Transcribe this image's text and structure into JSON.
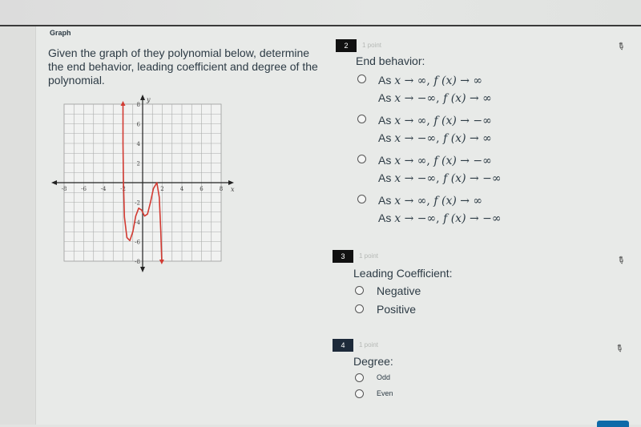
{
  "section_label": "Graph",
  "prompt": "Given the graph of they polynomial below, determine the end behavior, leading coefficient and degree of the polynomial.",
  "graph": {
    "x_axis_label": "x",
    "y_axis_label": "y",
    "x_ticks": [
      "-8",
      "-6",
      "-4",
      "-2",
      "2",
      "4",
      "6",
      "8"
    ],
    "y_ticks": [
      "8",
      "6",
      "4",
      "2",
      "-2",
      "-4",
      "-6",
      "-8"
    ],
    "curve_color": "#d23a32",
    "curve_points": [
      [
        -2.0,
        8.0
      ],
      [
        -2.0,
        4.0
      ],
      [
        -1.95,
        0.0
      ],
      [
        -1.85,
        -3.5
      ],
      [
        -1.6,
        -5.6
      ],
      [
        -1.3,
        -5.9
      ],
      [
        -1.0,
        -5.0
      ],
      [
        -0.7,
        -3.4
      ],
      [
        -0.4,
        -2.6
      ],
      [
        -0.1,
        -2.8
      ],
      [
        0.2,
        -3.4
      ],
      [
        0.5,
        -3.2
      ],
      [
        0.8,
        -2.0
      ],
      [
        1.1,
        -0.6
      ],
      [
        1.45,
        0.0
      ],
      [
        1.7,
        -1.5
      ],
      [
        1.85,
        -5.0
      ],
      [
        1.95,
        -8.0
      ]
    ]
  },
  "questions": [
    {
      "number": "2",
      "points": "1 point",
      "title": "End behavior:",
      "options": [
        {
          "line1_x": "∞",
          "line1_f": "∞",
          "line2_x": "−∞",
          "line2_f": "∞"
        },
        {
          "line1_x": "∞",
          "line1_f": "−∞",
          "line2_x": "−∞",
          "line2_f": "∞"
        },
        {
          "line1_x": "∞",
          "line1_f": "−∞",
          "line2_x": "−∞",
          "line2_f": "−∞"
        },
        {
          "line1_x": "∞",
          "line1_f": "∞",
          "line2_x": "−∞",
          "line2_f": "−∞"
        }
      ],
      "as_label": "As",
      "x_var": "x",
      "f_expr": "f (x)",
      "arrow": "→"
    },
    {
      "number": "3",
      "points": "1 point",
      "title": "Leading Coefficient:",
      "options": [
        "Negative",
        "Positive"
      ]
    },
    {
      "number": "4",
      "points": "1 point",
      "title": "Degree:",
      "options": [
        "Odd",
        "Even"
      ]
    }
  ]
}
